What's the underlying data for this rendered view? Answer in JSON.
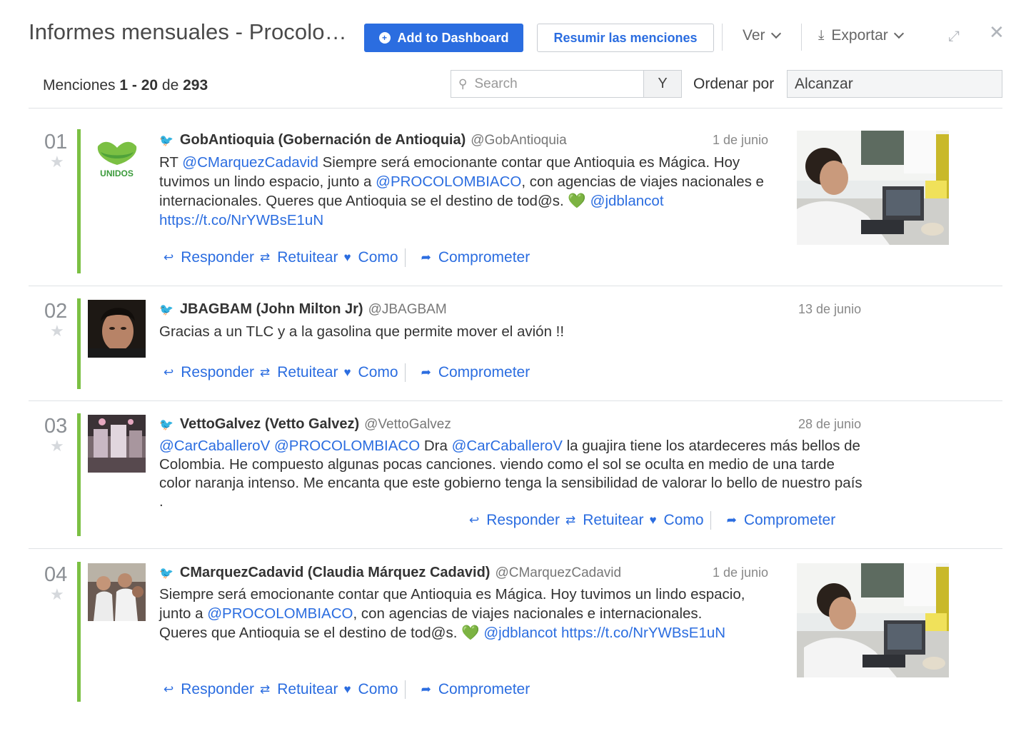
{
  "header": {
    "title": "Informes mensuales - Procolo…",
    "add_dashboard": "Add to Dashboard",
    "summarize": "Resumir las menciones",
    "view": "Ver",
    "export": "Exportar",
    "add_icon": "plus-circle-icon",
    "download_icon": "download-icon",
    "expand_icon": "expand-icon",
    "close_icon": "close-icon"
  },
  "toolbar": {
    "count_prefix": "Menciones ",
    "count_range": "1 - 20",
    "count_of": " de ",
    "count_total": "293",
    "search_placeholder": "Search",
    "y_button": "Y",
    "sort_label": "Ordenar por",
    "sort_value": "Alcanzar"
  },
  "actions": {
    "reply": "Responder",
    "retweet": "Retuitear",
    "like": "Como",
    "engage": "Comprometer"
  },
  "colors": {
    "accent": "#2b6de0",
    "sentiment_bar": "#7bc043",
    "twitter": "#1da1f2"
  },
  "mentions": [
    {
      "number": "01",
      "author": "GobAntioquia (Gobernación de Antioquia)",
      "handle": "@GobAntioquia",
      "date": "1 de junio",
      "avatar_text": "UNIDOS",
      "text": [
        {
          "t": "RT ",
          "link": false
        },
        {
          "t": "@CMarquezCadavid",
          "link": true
        },
        {
          "t": " Siempre será emocionante contar que Antioquia es Mágica. Hoy tuvimos un lindo espacio, junto a ",
          "link": false
        },
        {
          "t": "@PROCOLOMBIACO",
          "link": true
        },
        {
          "t": ", con agencias de viajes nacionales e internacionales. Queres que Antioquia se el destino de tod@s. ",
          "link": false
        },
        {
          "t": "💚",
          "emoji": true
        },
        {
          "t": " ",
          "link": false
        },
        {
          "t": "@jdblancot",
          "link": true
        },
        {
          "t": " ",
          "link": false
        },
        {
          "t": "https://t.co/NrYWBsE1uN",
          "link": true
        }
      ]
    },
    {
      "number": "02",
      "author": "JBAGBAM (John Milton Jr)",
      "handle": "@JBAGBAM",
      "date": "13 de junio",
      "text": [
        {
          "t": "Gracias a un TLC y a la gasolina que permite mover el avión !!",
          "link": false
        }
      ]
    },
    {
      "number": "03",
      "author": "VettoGalvez (Vetto Galvez)",
      "handle": "@VettoGalvez",
      "date": "28 de junio",
      "text": [
        {
          "t": "@CarCaballeroV",
          "link": true
        },
        {
          "t": " ",
          "link": false
        },
        {
          "t": "@PROCOLOMBIACO",
          "link": true
        },
        {
          "t": " Dra ",
          "link": false
        },
        {
          "t": "@CarCaballeroV",
          "link": true
        },
        {
          "t": " la guajira tiene los atardeceres más bellos de Colombia. He compuesto algunas pocas canciones. viendo como el sol se oculta en medio de una tarde color naranja intenso. Me encanta que este gobierno tenga la sensibilidad de valorar lo bello de nuestro país .",
          "link": false
        }
      ]
    },
    {
      "number": "04",
      "author": "CMarquezCadavid (Claudia Márquez Cadavid)",
      "handle": "@CMarquezCadavid",
      "date": "1 de junio",
      "text": [
        {
          "t": "Siempre será emocionante contar que Antioquia es Mágica. Hoy tuvimos un lindo espacio, junto a ",
          "link": false
        },
        {
          "t": "@PROCOLOMBIACO",
          "link": true
        },
        {
          "t": ", con agencias de viajes nacionales e internacionales. Queres que Antioquia se el destino de tod@s. ",
          "link": false
        },
        {
          "t": "💚",
          "emoji": true
        },
        {
          "t": " ",
          "link": false
        },
        {
          "t": "@jdblancot",
          "link": true
        },
        {
          "t": " ",
          "link": false
        },
        {
          "t": "https://t.co/NrYWBsE1uN",
          "link": true
        }
      ]
    }
  ]
}
